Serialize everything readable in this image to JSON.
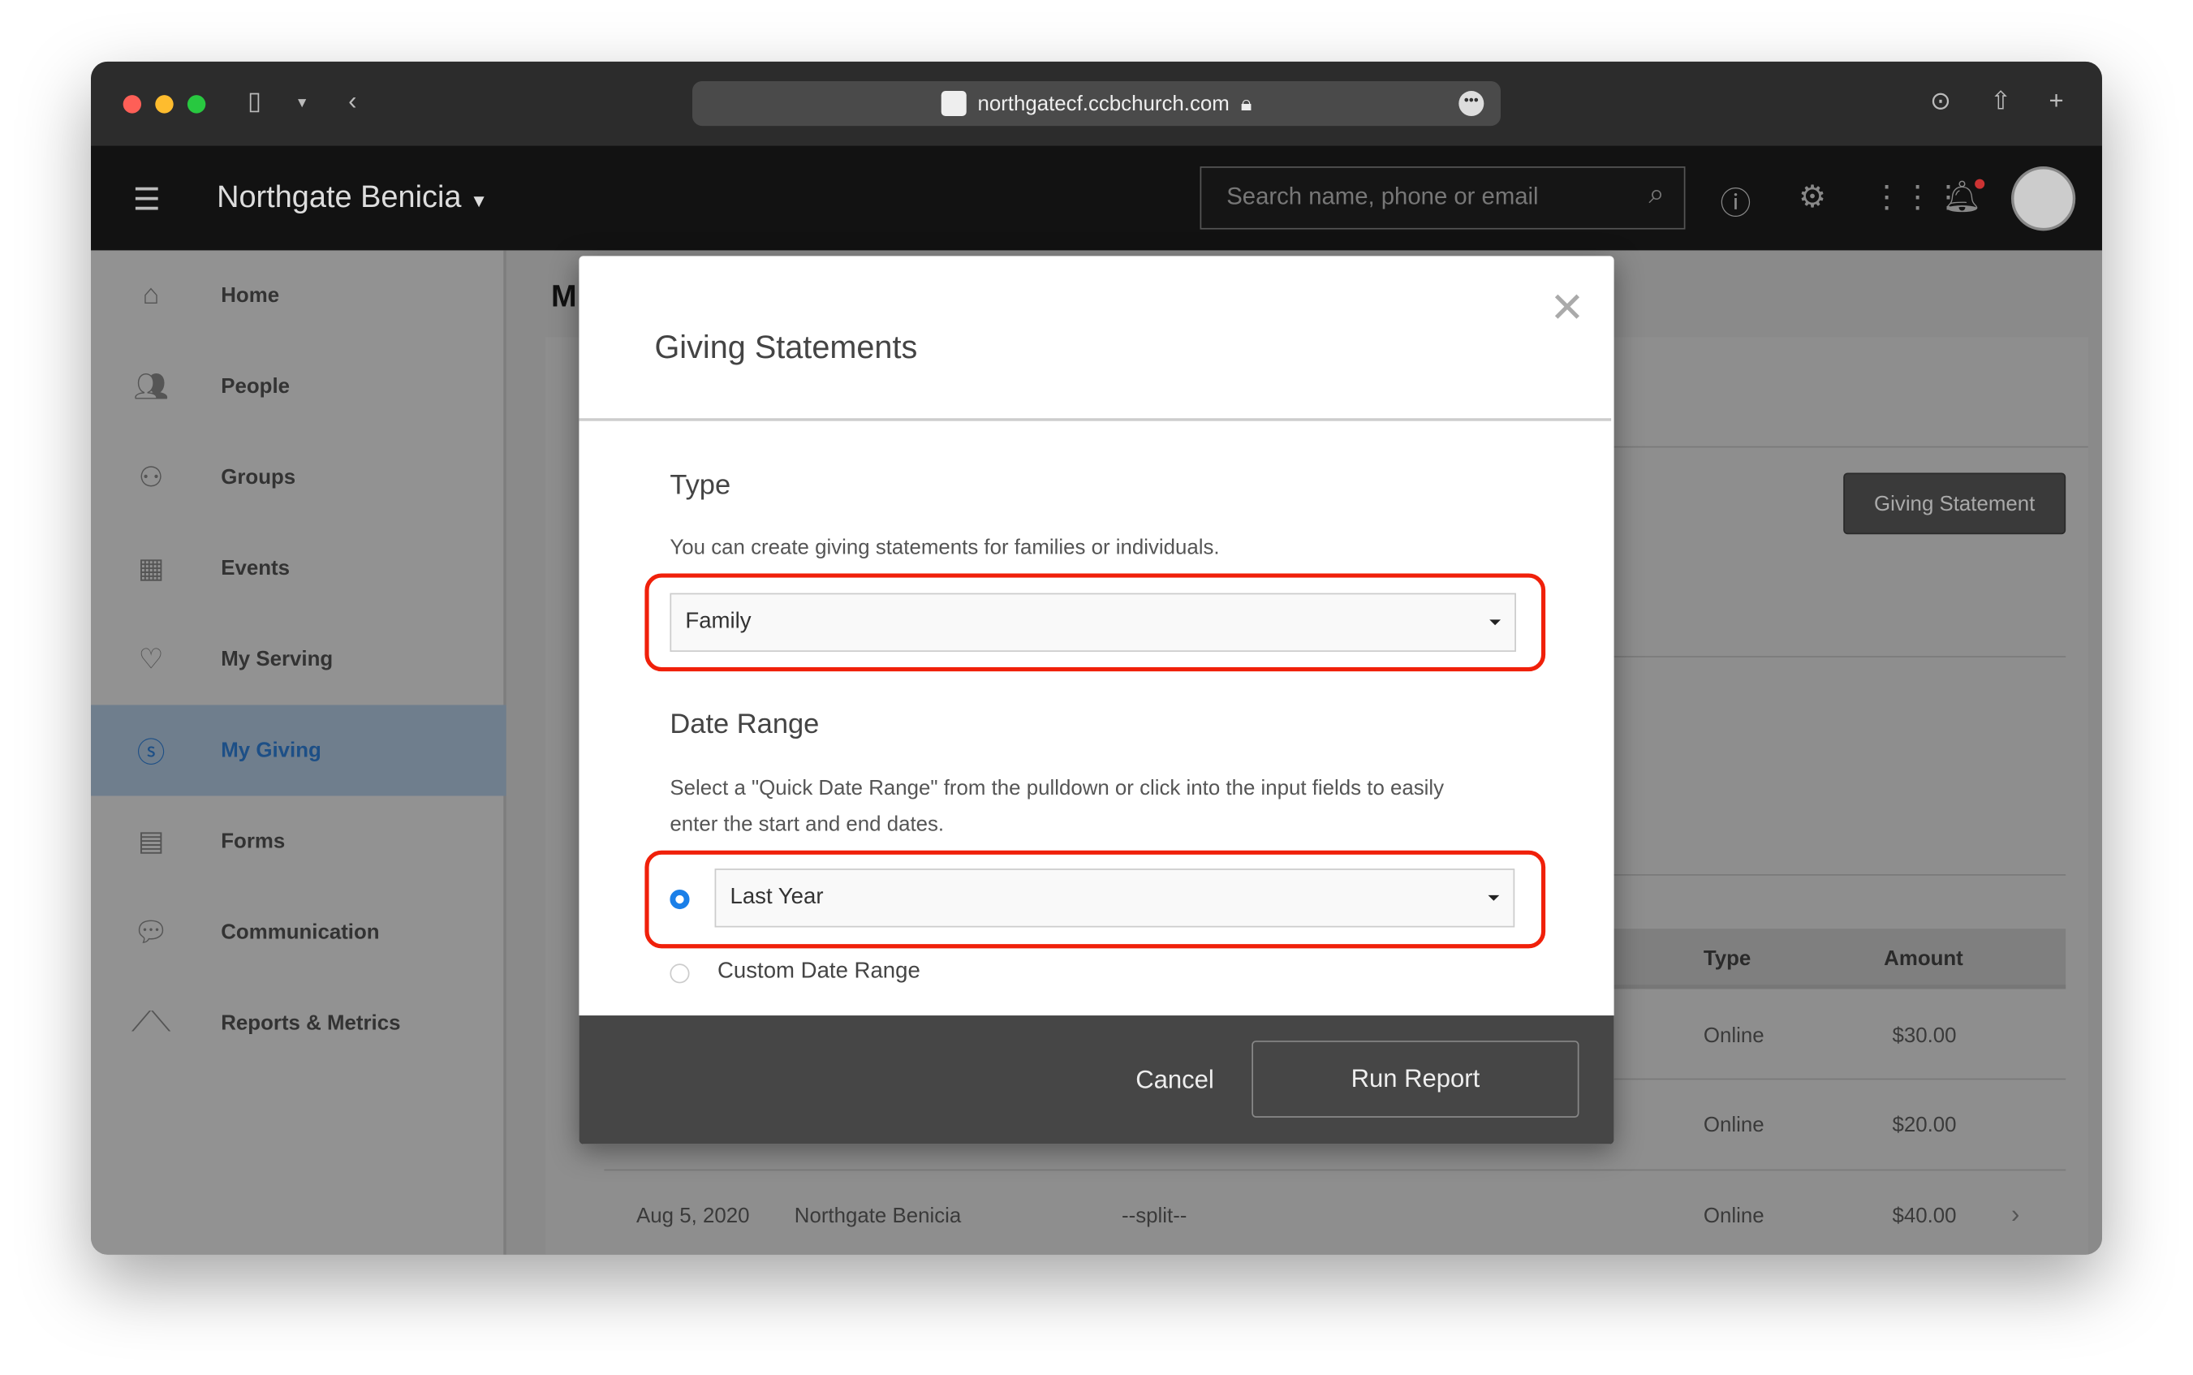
{
  "browser": {
    "url": "northgatecf.ccbchurch.com"
  },
  "header": {
    "org_name": "Northgate Benicia",
    "search_placeholder": "Search name, phone or email"
  },
  "sidebar": {
    "items": [
      {
        "label": "Home",
        "icon": "home-icon"
      },
      {
        "label": "People",
        "icon": "people-icon"
      },
      {
        "label": "Groups",
        "icon": "groups-icon"
      },
      {
        "label": "Events",
        "icon": "calendar-icon"
      },
      {
        "label": "My Serving",
        "icon": "heart-icon"
      },
      {
        "label": "My Giving",
        "icon": "dollar-icon",
        "active": true
      },
      {
        "label": "Forms",
        "icon": "clipboard-icon"
      },
      {
        "label": "Communication",
        "icon": "chat-icon"
      },
      {
        "label": "Reports & Metrics",
        "icon": "chart-icon"
      }
    ]
  },
  "main": {
    "title_partial": "M",
    "giving_statement_button": "Giving Statement",
    "table": {
      "columns": {
        "type": "Type",
        "amount": "Amount"
      },
      "rows": [
        {
          "date": "",
          "name": "",
          "fund": "",
          "type": "Online",
          "amount": "$30.00"
        },
        {
          "date": "",
          "name": "",
          "fund": "",
          "type": "Online",
          "amount": "$20.00"
        },
        {
          "date": "Aug 5, 2020",
          "name": "Northgate Benicia",
          "fund": "--split--",
          "type": "Online",
          "amount": "$40.00"
        }
      ]
    }
  },
  "modal": {
    "title": "Giving Statements",
    "type_heading": "Type",
    "type_help": "You can create giving statements for families or individuals.",
    "type_value": "Family",
    "date_heading": "Date Range",
    "date_help_1": "Select a \"Quick Date Range\" from the pulldown or click into the input fields to easily",
    "date_help_2": "enter the start and end dates.",
    "quick_range_value": "Last Year",
    "custom_range_label": "Custom Date Range",
    "quick_range_selected": true,
    "cancel_label": "Cancel",
    "run_label": "Run Report"
  },
  "colors": {
    "highlight": "#f0200a",
    "radio": "#1a7fe8",
    "footer": "#464646"
  }
}
